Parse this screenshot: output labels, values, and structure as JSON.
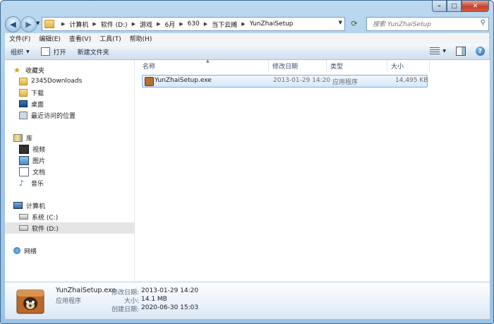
{
  "window": {
    "min": "–",
    "max": "□",
    "close": "✕"
  },
  "address": {
    "crumbs": [
      "计算机",
      "软件 (D:)",
      "游戏",
      "6月",
      "630",
      "当下云摊",
      "YunZhaiSetup"
    ],
    "search_placeholder": "搜索 YunZhaiSetup"
  },
  "menu": [
    "文件(F)",
    "编辑(E)",
    "查看(V)",
    "工具(T)",
    "帮助(H)"
  ],
  "toolbar": {
    "organize": "组织",
    "open": "打开",
    "new_folder": "新建文件夹"
  },
  "nav": {
    "favorites": "收藏夹",
    "fav_items": [
      "2345Downloads",
      "下载",
      "桌面",
      "最近访问的位置"
    ],
    "libraries": "库",
    "lib_items": [
      "视频",
      "图片",
      "文档",
      "音乐"
    ],
    "computer": "计算机",
    "drives": [
      "系统 (C:)",
      "软件 (D:)"
    ],
    "network": "网络"
  },
  "columns": [
    "名称",
    "修改日期",
    "类型",
    "大小"
  ],
  "files": [
    {
      "name": "YunZhaiSetup.exe",
      "modified": "2013-01-29 14:20",
      "type": "应用程序",
      "size": "14,495 KB"
    }
  ],
  "details": {
    "name": "YunZhaiSetup.exe",
    "type": "应用程序",
    "modified_label": "修改日期:",
    "modified": "2013-01-29 14:20",
    "size_label": "大小:",
    "size": "14.1 MB",
    "created_label": "创建日期:",
    "created": "2020-06-30 15:03"
  }
}
